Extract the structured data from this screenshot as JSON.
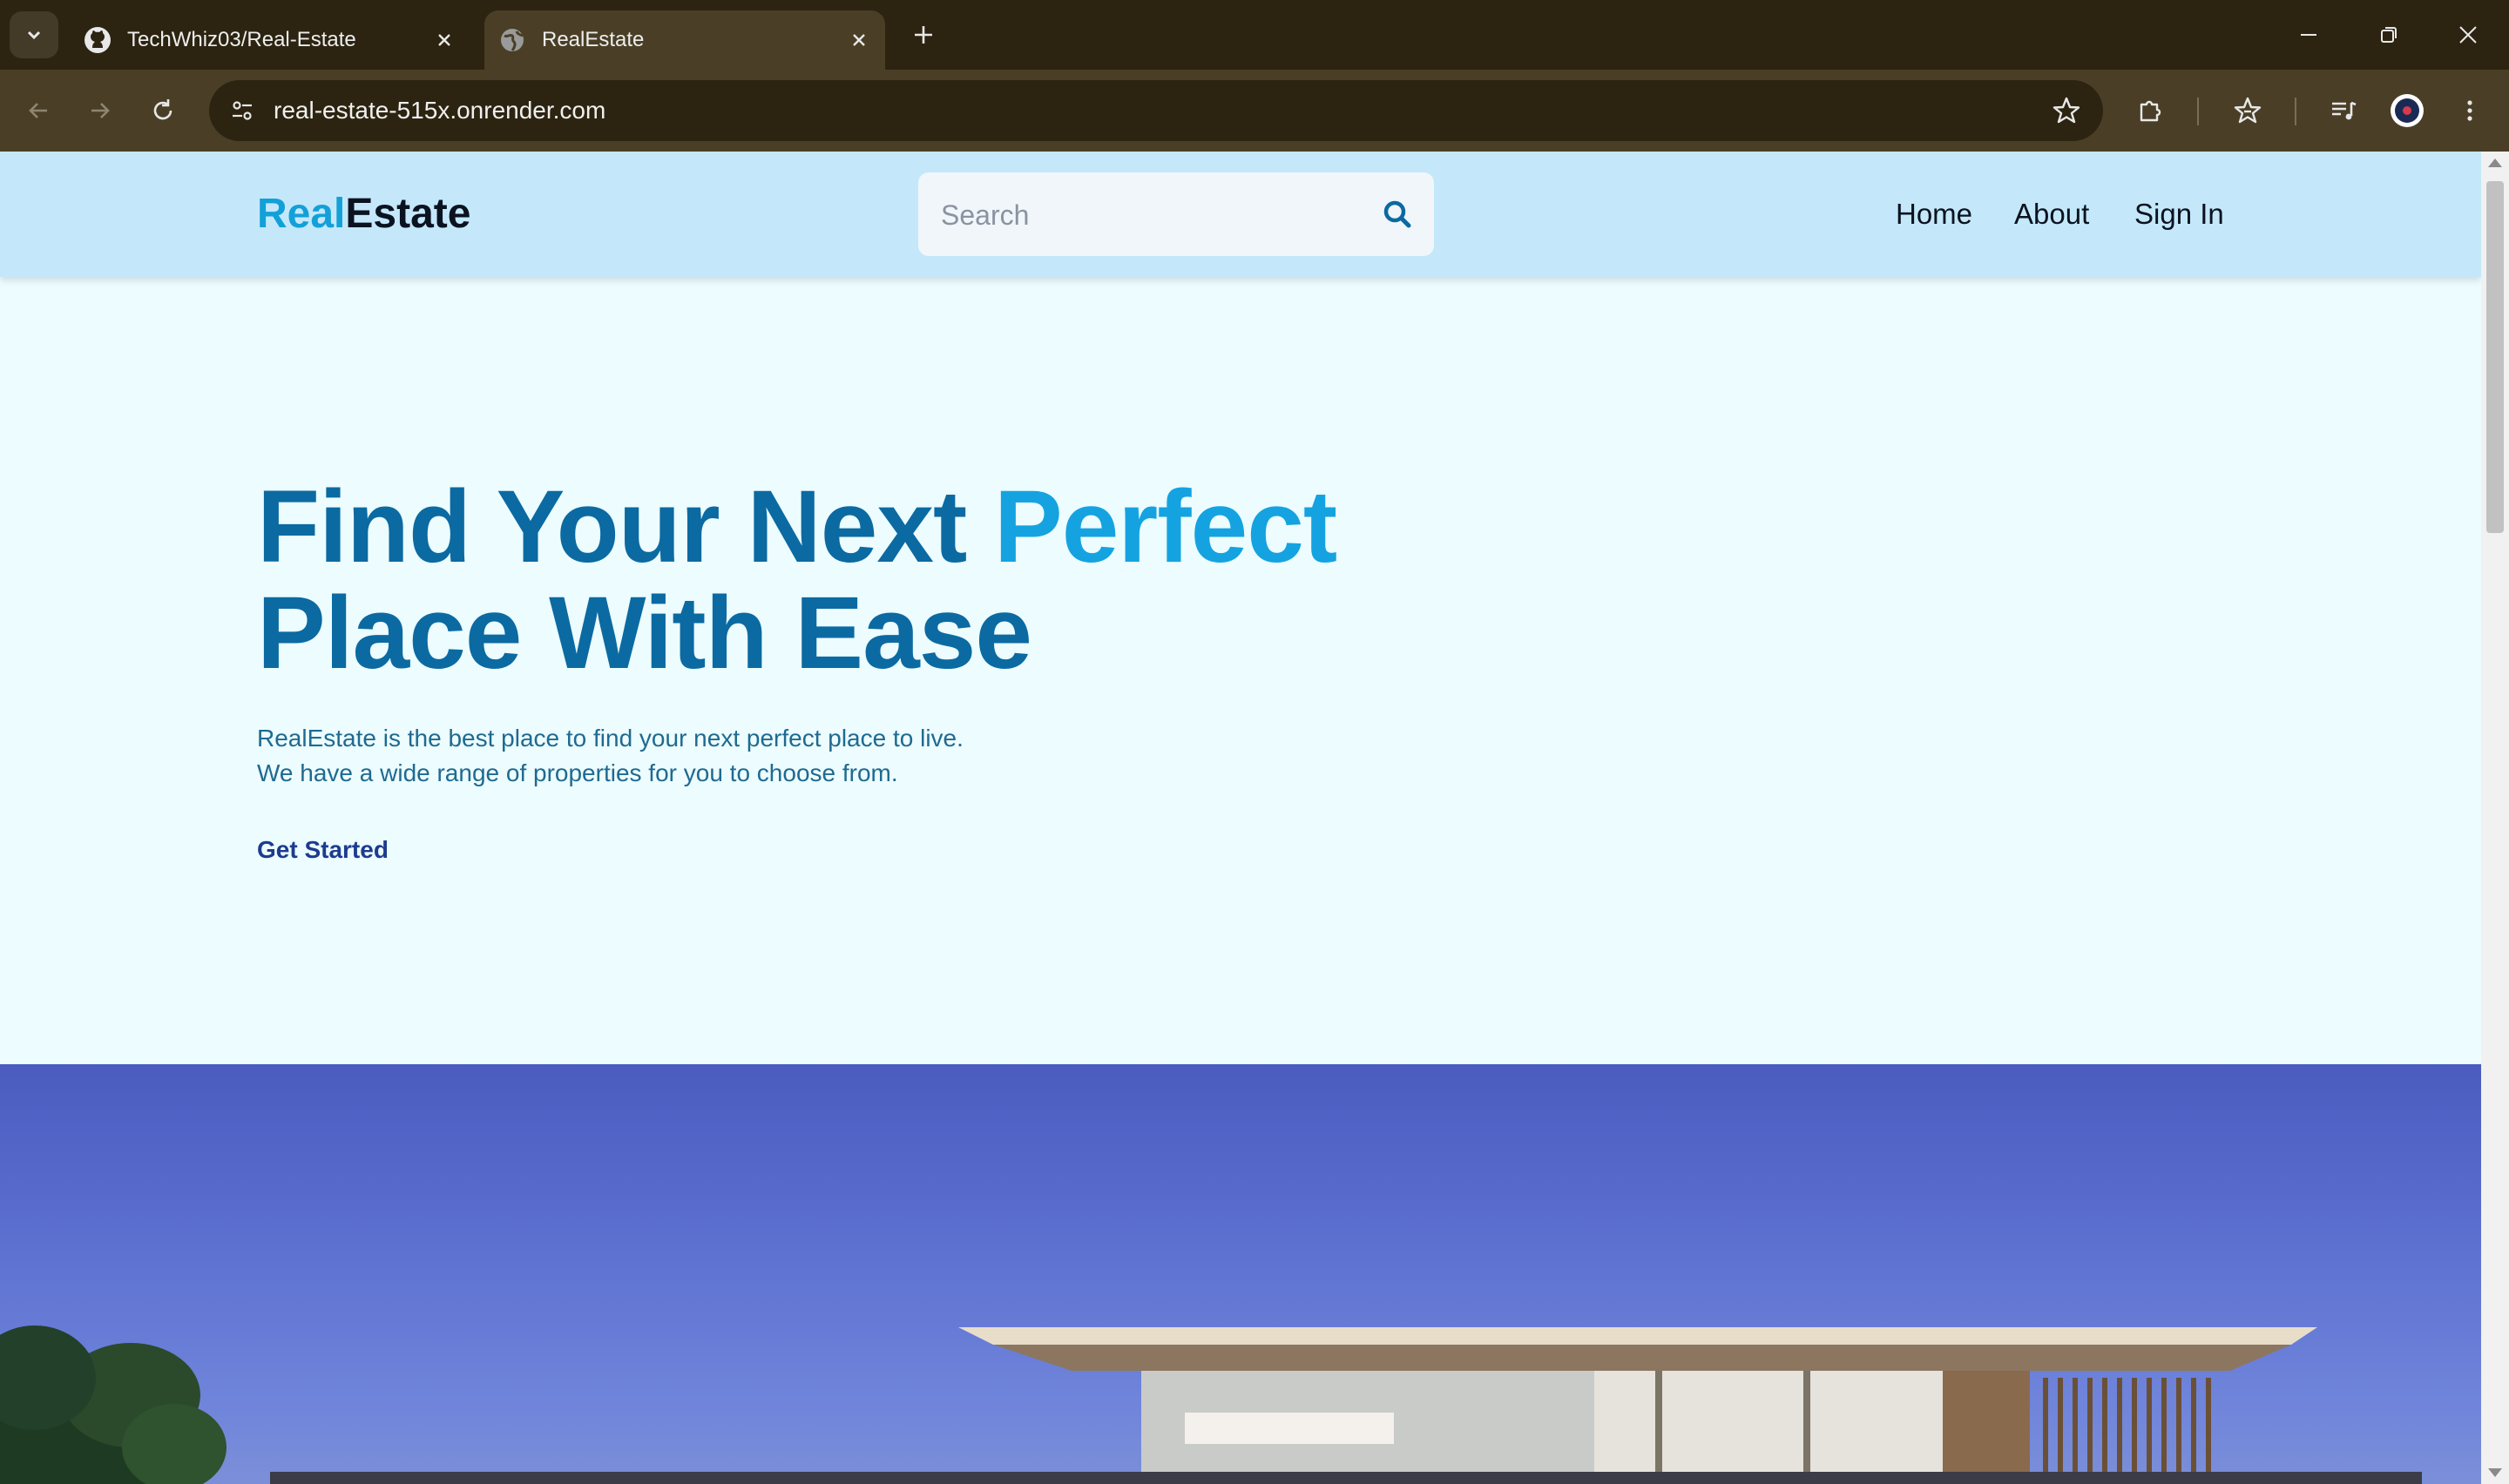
{
  "browser": {
    "tabs": [
      {
        "title": "TechWhiz03/Real-Estate",
        "favicon": "github-icon",
        "active": false
      },
      {
        "title": "RealEstate",
        "favicon": "globe-icon",
        "active": true
      }
    ],
    "url": "real-estate-515x.onrender.com"
  },
  "header": {
    "logo_part1": "Real",
    "logo_part2": "Estate",
    "search_placeholder": "Search",
    "search_value": "",
    "nav": [
      {
        "label": "Home"
      },
      {
        "label": "About"
      },
      {
        "label": "Sign In"
      }
    ]
  },
  "hero": {
    "title_part1": "Find Your Next ",
    "title_accent": "Perfect",
    "title_part2": "Place With Ease",
    "desc_line1": "RealEstate is the best place to find your next perfect place to live.",
    "desc_line2": "We have a wide range of properties for you to choose from.",
    "cta": "Get Started"
  },
  "colors": {
    "header_bg": "#c4e8fa",
    "page_bg": "#ecfcff",
    "title": "#0b6aa1",
    "accent": "#14a3e0",
    "cta": "#1d3c8e",
    "browser_frame": "#2c2411"
  }
}
